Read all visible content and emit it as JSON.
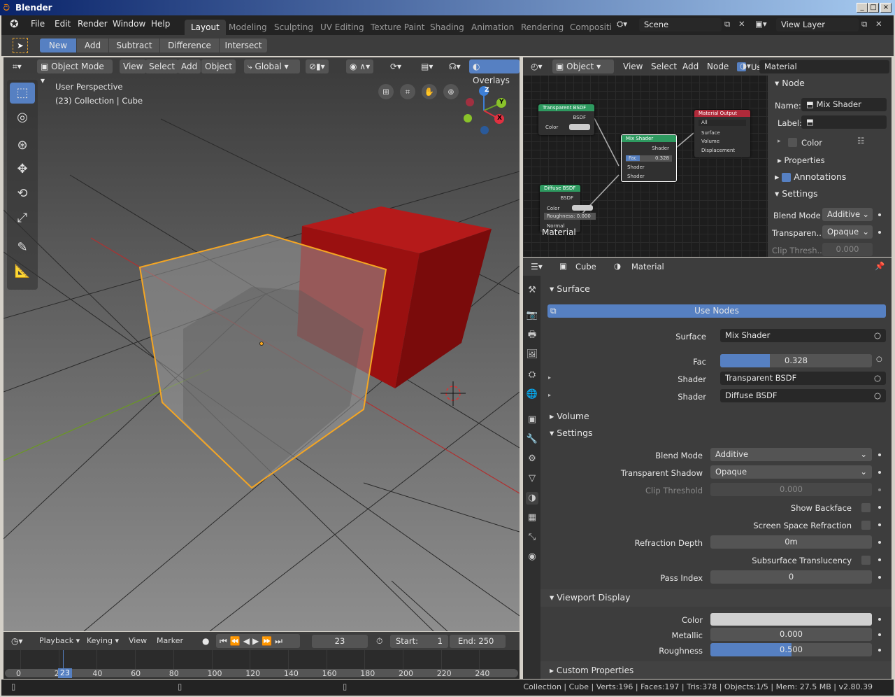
{
  "window": {
    "title": "Blender",
    "buttons": [
      "_",
      "□",
      "×"
    ]
  },
  "menu": [
    "File",
    "Edit",
    "Render",
    "Window",
    "Help"
  ],
  "workspaces": [
    "Layout",
    "Modeling",
    "Sculpting",
    "UV Editing",
    "Texture Paint",
    "Shading",
    "Animation",
    "Rendering",
    "Compositin"
  ],
  "scene": "Scene",
  "view_layer": "View Layer",
  "toolbar": {
    "modes": [
      "New",
      "Add",
      "Subtract",
      "Difference",
      "Intersect"
    ]
  },
  "viewport": {
    "mode": "Object Mode",
    "menus": [
      "View",
      "Select",
      "Add",
      "Object"
    ],
    "orientation": "Global",
    "overlays": "Overlays",
    "info_line1": "User Perspective",
    "info_line2": "(23) Collection | Cube",
    "gizmo": {
      "x": "X",
      "y": "Y",
      "z": "Z"
    }
  },
  "node_editor": {
    "object": "Object",
    "menus": [
      "View",
      "Select",
      "Add",
      "Node"
    ],
    "use_nodes": "Use Nodes",
    "material": "Material",
    "frame_label": "Material",
    "nodes": {
      "transparent": {
        "title": "Transparent BSDF",
        "out": "BSDF",
        "color": "Color"
      },
      "diffuse": {
        "title": "Diffuse BSDF",
        "out": "BSDF",
        "color": "Color",
        "roughness": "Roughness:",
        "roughness_val": "0.000",
        "normal": "Normal"
      },
      "mix": {
        "title": "Mix Shader",
        "out": "Shader",
        "fac": "Fac",
        "fac_val": "0.328",
        "in1": "Shader",
        "in2": "Shader"
      },
      "output": {
        "title": "Material Output",
        "target": "All",
        "surface": "Surface",
        "volume": "Volume",
        "displacement": "Displacement"
      }
    },
    "sidebar": {
      "node": "Node",
      "name_label": "Name:",
      "name": "Mix Shader",
      "label_label": "Label:",
      "color": "Color",
      "properties": "Properties",
      "annotations": "Annotations",
      "settings": "Settings",
      "blend_mode_label": "Blend Mode",
      "blend_mode": "Additive",
      "transparent_label": "Transparen..",
      "transparent": "Opaque",
      "clip_label": "Clip Thresh..",
      "clip": "0.000"
    }
  },
  "properties": {
    "object": "Cube",
    "material": "Material",
    "surface": "Surface",
    "use_nodes": "Use Nodes",
    "surface_label": "Surface",
    "surface_val": "Mix Shader",
    "fac_label": "Fac",
    "fac_val": "0.328",
    "fac_fraction": 0.328,
    "shader1_label": "Shader",
    "shader1": "Transparent BSDF",
    "shader2_label": "Shader",
    "shader2": "Diffuse BSDF",
    "volume": "Volume",
    "settings": "Settings",
    "blend_mode_label": "Blend Mode",
    "blend_mode": "Additive",
    "shadow_label": "Transparent Shadow",
    "shadow": "Opaque",
    "clip_label": "Clip Threshold",
    "clip": "0.000",
    "backface": "Show Backface",
    "ssr": "Screen Space Refraction",
    "refr_label": "Refraction Depth",
    "refr": "0m",
    "sss": "Subsurface Translucency",
    "pass_label": "Pass Index",
    "pass": "0",
    "viewport_display": "Viewport Display",
    "color_label": "Color",
    "metallic_label": "Metallic",
    "metallic": "0.000",
    "roughness_label": "Roughness",
    "roughness": "0.500",
    "roughness_fraction": 0.5,
    "custom": "Custom Properties"
  },
  "timeline": {
    "menus": [
      "Playback",
      "Keying",
      "View",
      "Marker"
    ],
    "frame": "23",
    "start_label": "Start:",
    "start": "1",
    "end_label": "End:",
    "end": "250",
    "ticks": [
      "0",
      "20",
      "40",
      "60",
      "80",
      "100",
      "120",
      "140",
      "160",
      "180",
      "200",
      "220",
      "240"
    ],
    "current": "23"
  },
  "status": "Collection | Cube | Verts:196 | Faces:197 | Tris:378 | Objects:1/5 | Mem: 27.5 MB | v2.80.39",
  "colors": {
    "accent": "#5680c2",
    "selection": "#f5a623",
    "cube": "#9a1010"
  }
}
